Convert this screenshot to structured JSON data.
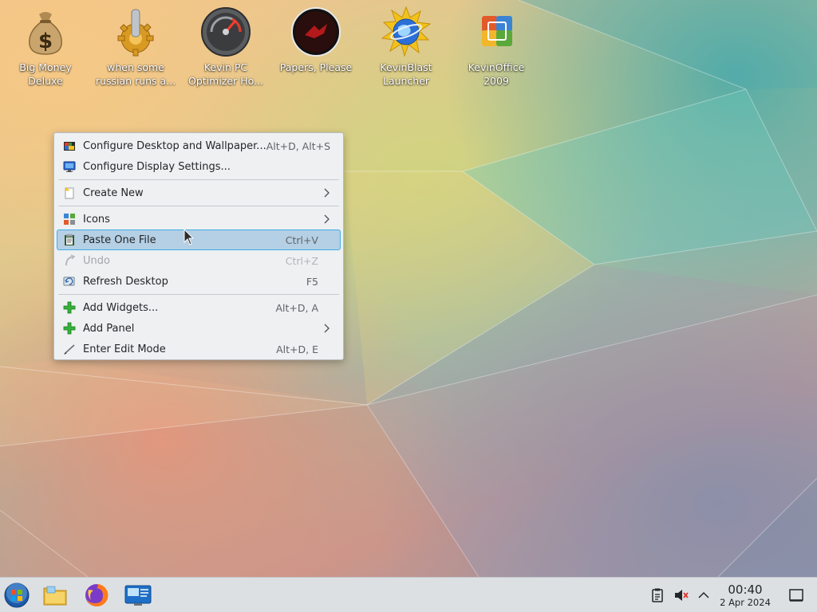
{
  "desktop": {
    "icons": [
      {
        "label": "Big Money\nDeluxe",
        "icon": "money-bag-icon"
      },
      {
        "label": "when some\nrussian runs a...",
        "icon": "golden-gear-icon"
      },
      {
        "label": "Kevin PC\nOptimizer Ho...",
        "icon": "speedometer-icon"
      },
      {
        "label": "Papers, Please",
        "icon": "papers-please-icon"
      },
      {
        "label": "KevinBlast\nLauncher",
        "icon": "kevinblast-globe-icon"
      },
      {
        "label": "KevinOffice\n2009",
        "icon": "office-logo-icon"
      }
    ]
  },
  "context_menu": {
    "items": [
      {
        "label": "Configure Desktop and Wallpaper...",
        "shortcut": "Alt+D, Alt+S",
        "icon": "palette-icon"
      },
      {
        "label": "Configure Display Settings...",
        "shortcut": "",
        "icon": "monitor-icon"
      },
      {
        "label": "Create New",
        "shortcut": "",
        "icon": "new-document-icon",
        "submenu": true
      },
      {
        "label": "Icons",
        "shortcut": "",
        "icon": "icons-grid-icon",
        "submenu": true
      },
      {
        "label": "Paste One File",
        "shortcut": "Ctrl+V",
        "icon": "paste-icon",
        "highlighted": true
      },
      {
        "label": "Undo",
        "shortcut": "Ctrl+Z",
        "icon": "undo-icon",
        "disabled": true
      },
      {
        "label": "Refresh Desktop",
        "shortcut": "F5",
        "icon": "refresh-icon"
      },
      {
        "label": "Add Widgets...",
        "shortcut": "Alt+D, A",
        "icon": "plus-icon"
      },
      {
        "label": "Add Panel",
        "shortcut": "",
        "icon": "plus-icon",
        "submenu": true
      },
      {
        "label": "Enter Edit Mode",
        "shortcut": "Alt+D, E",
        "icon": "edit-brush-icon"
      }
    ]
  },
  "taskbar": {
    "launchers": [
      "start-orb-icon",
      "file-manager-icon",
      "firefox-icon",
      "system-settings-icon"
    ],
    "tray": [
      "clipboard-icon",
      "volume-muted-icon",
      "expand-tray-icon"
    ],
    "clock": {
      "time": "00:40",
      "date": "2 Apr 2024"
    },
    "show_desktop": "show-desktop-icon"
  },
  "colors": {
    "menu_bg": "#eef0f1",
    "highlight_bg": "#b5cfe4",
    "highlight_border": "#3daee9",
    "taskbar_bg": "#dde0e3"
  }
}
